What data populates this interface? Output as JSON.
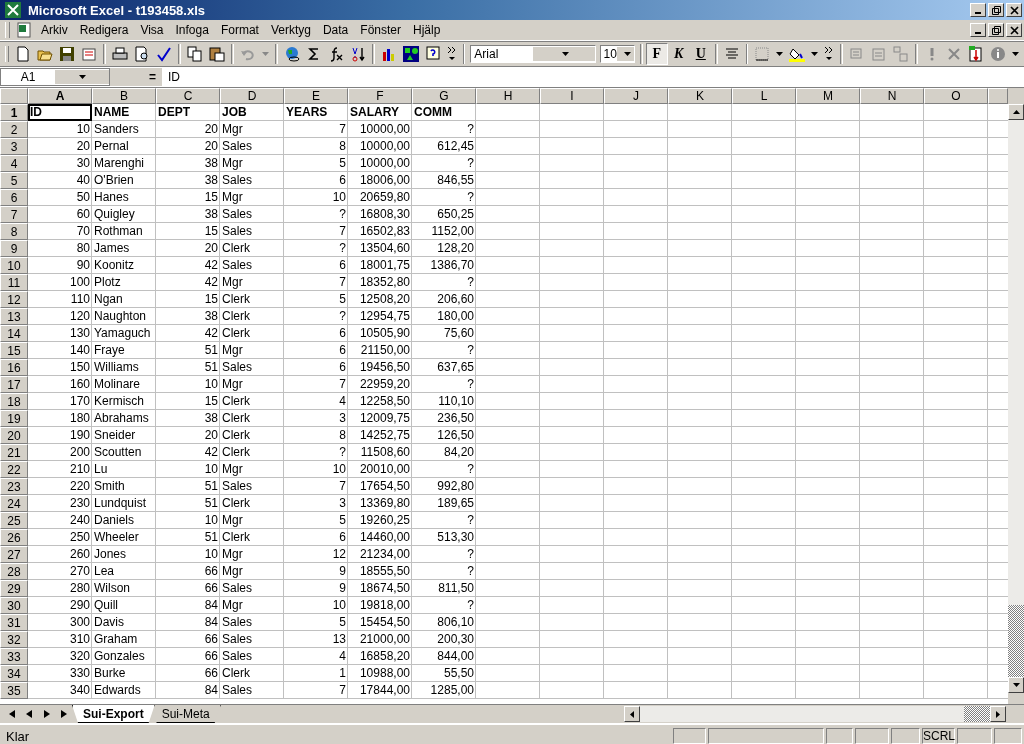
{
  "window": {
    "title": "Microsoft Excel - t193458.xls"
  },
  "menu": [
    "Arkiv",
    "Redigera",
    "Visa",
    "Infoga",
    "Format",
    "Verktyg",
    "Data",
    "Fönster",
    "Hjälp"
  ],
  "toolbar": {
    "font": "Arial",
    "size": "10",
    "format_buttons": [
      {
        "label": "F",
        "kind": "bold",
        "on": true
      },
      {
        "label": "K",
        "kind": "italic",
        "on": false
      },
      {
        "label": "U",
        "kind": "underline",
        "on": false
      }
    ]
  },
  "formula_bar": {
    "name_box": "A1",
    "equals": "=",
    "formula": "ID"
  },
  "columns": [
    {
      "label": "A",
      "kind": "number",
      "selected": true
    },
    {
      "label": "B",
      "kind": "text",
      "selected": false
    },
    {
      "label": "C",
      "kind": "number",
      "selected": false
    },
    {
      "label": "D",
      "kind": "text",
      "selected": false
    },
    {
      "label": "E",
      "kind": "number",
      "selected": false
    },
    {
      "label": "F",
      "kind": "number",
      "selected": false
    },
    {
      "label": "G",
      "kind": "number",
      "selected": false
    },
    {
      "label": "H",
      "selected": false
    },
    {
      "label": "I",
      "selected": false
    },
    {
      "label": "J",
      "selected": false
    },
    {
      "label": "K",
      "selected": false
    },
    {
      "label": "L",
      "selected": false
    },
    {
      "label": "M",
      "selected": false
    },
    {
      "label": "N",
      "selected": false
    },
    {
      "label": "O",
      "selected": false
    }
  ],
  "rows": [
    {
      "number": "1",
      "kind": "header",
      "selected": true,
      "cells": [
        "ID",
        "NAME",
        "DEPT",
        "JOB",
        "YEARS",
        "SALARY",
        "COMM"
      ]
    },
    {
      "number": "2",
      "kind": "data",
      "selected": false,
      "cells": [
        "10",
        "Sanders",
        "20",
        "Mgr",
        "7",
        "10000,00",
        "?"
      ]
    },
    {
      "number": "3",
      "kind": "data",
      "selected": false,
      "cells": [
        "20",
        "Pernal",
        "20",
        "Sales",
        "8",
        "10000,00",
        "612,45"
      ]
    },
    {
      "number": "4",
      "kind": "data",
      "selected": false,
      "cells": [
        "30",
        "Marenghi",
        "38",
        "Mgr",
        "5",
        "10000,00",
        "?"
      ]
    },
    {
      "number": "5",
      "kind": "data",
      "selected": false,
      "cells": [
        "40",
        "O'Brien",
        "38",
        "Sales",
        "6",
        "18006,00",
        "846,55"
      ]
    },
    {
      "number": "6",
      "kind": "data",
      "selected": false,
      "cells": [
        "50",
        "Hanes",
        "15",
        "Mgr",
        "10",
        "20659,80",
        "?"
      ]
    },
    {
      "number": "7",
      "kind": "data",
      "selected": false,
      "cells": [
        "60",
        "Quigley",
        "38",
        "Sales",
        "?",
        "16808,30",
        "650,25"
      ]
    },
    {
      "number": "8",
      "kind": "data",
      "selected": false,
      "cells": [
        "70",
        "Rothman",
        "15",
        "Sales",
        "7",
        "16502,83",
        "1152,00"
      ]
    },
    {
      "number": "9",
      "kind": "data",
      "selected": false,
      "cells": [
        "80",
        "James",
        "20",
        "Clerk",
        "?",
        "13504,60",
        "128,20"
      ]
    },
    {
      "number": "10",
      "kind": "data",
      "selected": false,
      "cells": [
        "90",
        "Koonitz",
        "42",
        "Sales",
        "6",
        "18001,75",
        "1386,70"
      ]
    },
    {
      "number": "11",
      "kind": "data",
      "selected": false,
      "cells": [
        "100",
        "Plotz",
        "42",
        "Mgr",
        "7",
        "18352,80",
        "?"
      ]
    },
    {
      "number": "12",
      "kind": "data",
      "selected": false,
      "cells": [
        "110",
        "Ngan",
        "15",
        "Clerk",
        "5",
        "12508,20",
        "206,60"
      ]
    },
    {
      "number": "13",
      "kind": "data",
      "selected": false,
      "cells": [
        "120",
        "Naughton",
        "38",
        "Clerk",
        "?",
        "12954,75",
        "180,00"
      ]
    },
    {
      "number": "14",
      "kind": "data",
      "selected": false,
      "cells": [
        "130",
        "Yamaguch",
        "42",
        "Clerk",
        "6",
        "10505,90",
        "75,60"
      ]
    },
    {
      "number": "15",
      "kind": "data",
      "selected": false,
      "cells": [
        "140",
        "Fraye",
        "51",
        "Mgr",
        "6",
        "21150,00",
        "?"
      ]
    },
    {
      "number": "16",
      "kind": "data",
      "selected": false,
      "cells": [
        "150",
        "Williams",
        "51",
        "Sales",
        "6",
        "19456,50",
        "637,65"
      ]
    },
    {
      "number": "17",
      "kind": "data",
      "selected": false,
      "cells": [
        "160",
        "Molinare",
        "10",
        "Mgr",
        "7",
        "22959,20",
        "?"
      ]
    },
    {
      "number": "18",
      "kind": "data",
      "selected": false,
      "cells": [
        "170",
        "Kermisch",
        "15",
        "Clerk",
        "4",
        "12258,50",
        "110,10"
      ]
    },
    {
      "number": "19",
      "kind": "data",
      "selected": false,
      "cells": [
        "180",
        "Abrahams",
        "38",
        "Clerk",
        "3",
        "12009,75",
        "236,50"
      ]
    },
    {
      "number": "20",
      "kind": "data",
      "selected": false,
      "cells": [
        "190",
        "Sneider",
        "20",
        "Clerk",
        "8",
        "14252,75",
        "126,50"
      ]
    },
    {
      "number": "21",
      "kind": "data",
      "selected": false,
      "cells": [
        "200",
        "Scoutten",
        "42",
        "Clerk",
        "?",
        "11508,60",
        "84,20"
      ]
    },
    {
      "number": "22",
      "kind": "data",
      "selected": false,
      "cells": [
        "210",
        "Lu",
        "10",
        "Mgr",
        "10",
        "20010,00",
        "?"
      ]
    },
    {
      "number": "23",
      "kind": "data",
      "selected": false,
      "cells": [
        "220",
        "Smith",
        "51",
        "Sales",
        "7",
        "17654,50",
        "992,80"
      ]
    },
    {
      "number": "24",
      "kind": "data",
      "selected": false,
      "cells": [
        "230",
        "Lundquist",
        "51",
        "Clerk",
        "3",
        "13369,80",
        "189,65"
      ]
    },
    {
      "number": "25",
      "kind": "data",
      "selected": false,
      "cells": [
        "240",
        "Daniels",
        "10",
        "Mgr",
        "5",
        "19260,25",
        "?"
      ]
    },
    {
      "number": "26",
      "kind": "data",
      "selected": false,
      "cells": [
        "250",
        "Wheeler",
        "51",
        "Clerk",
        "6",
        "14460,00",
        "513,30"
      ]
    },
    {
      "number": "27",
      "kind": "data",
      "selected": false,
      "cells": [
        "260",
        "Jones",
        "10",
        "Mgr",
        "12",
        "21234,00",
        "?"
      ]
    },
    {
      "number": "28",
      "kind": "data",
      "selected": false,
      "cells": [
        "270",
        "Lea",
        "66",
        "Mgr",
        "9",
        "18555,50",
        "?"
      ]
    },
    {
      "number": "29",
      "kind": "data",
      "selected": false,
      "cells": [
        "280",
        "Wilson",
        "66",
        "Sales",
        "9",
        "18674,50",
        "811,50"
      ]
    },
    {
      "number": "30",
      "kind": "data",
      "selected": false,
      "cells": [
        "290",
        "Quill",
        "84",
        "Mgr",
        "10",
        "19818,00",
        "?"
      ]
    },
    {
      "number": "31",
      "kind": "data",
      "selected": false,
      "cells": [
        "300",
        "Davis",
        "84",
        "Sales",
        "5",
        "15454,50",
        "806,10"
      ]
    },
    {
      "number": "32",
      "kind": "data",
      "selected": false,
      "cells": [
        "310",
        "Graham",
        "66",
        "Sales",
        "13",
        "21000,00",
        "200,30"
      ]
    },
    {
      "number": "33",
      "kind": "data",
      "selected": false,
      "cells": [
        "320",
        "Gonzales",
        "66",
        "Sales",
        "4",
        "16858,20",
        "844,00"
      ]
    },
    {
      "number": "34",
      "kind": "data",
      "selected": false,
      "cells": [
        "330",
        "Burke",
        "66",
        "Clerk",
        "1",
        "10988,00",
        "55,50"
      ]
    },
    {
      "number": "35",
      "kind": "data",
      "selected": false,
      "cells": [
        "340",
        "Edwards",
        "84",
        "Sales",
        "7",
        "17844,00",
        "1285,00"
      ]
    }
  ],
  "sheet_tabs": [
    {
      "label": "Sui-Export",
      "selected": true
    },
    {
      "label": "Sui-Meta",
      "selected": false
    }
  ],
  "status_bar": {
    "text": "Klar",
    "indicators": [
      "SCRL"
    ]
  }
}
